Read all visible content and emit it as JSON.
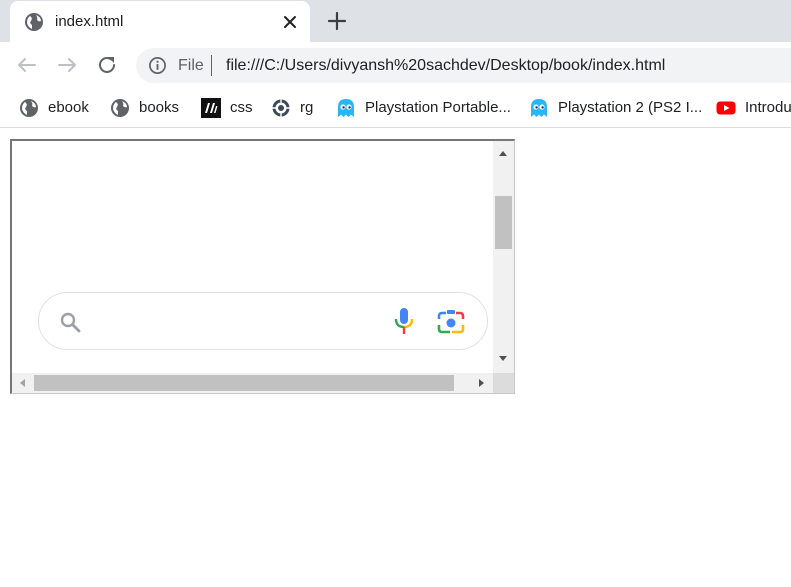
{
  "tab": {
    "title": "index.html"
  },
  "omnibox": {
    "scheme_label": "File",
    "url": "file:///C:/Users/divyansh%20sachdev/Desktop/book/index.html"
  },
  "bookmarks": [
    {
      "label": "ebook",
      "icon": "globe-icon"
    },
    {
      "label": "books",
      "icon": "globe-icon"
    },
    {
      "label": "css",
      "icon": "css-logo-icon"
    },
    {
      "label": "rg",
      "icon": "gear-icon"
    },
    {
      "label": "Playstation Portable...",
      "icon": "ghost-icon"
    },
    {
      "label": "Playstation 2 (PS2 I...",
      "icon": "ghost-icon"
    },
    {
      "label": "Introdu",
      "icon": "youtube-icon"
    }
  ],
  "colors": {
    "tabstrip": "#dee1e6",
    "omnibox_bg": "#f1f3f4",
    "google_blue": "#4285f4",
    "google_red": "#ea4335",
    "google_yellow": "#fbbc04",
    "google_green": "#34a853",
    "youtube_red": "#ff0000",
    "ghost_cyan": "#29b6f6"
  }
}
